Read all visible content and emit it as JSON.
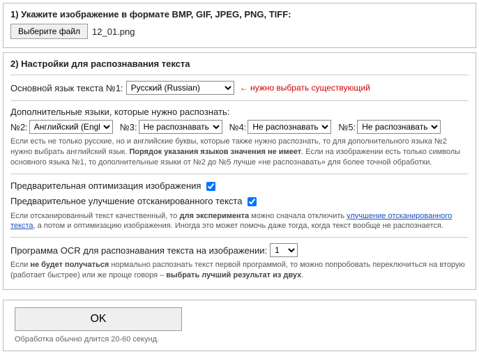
{
  "section1": {
    "title": "1) Укажите изображение в формате BMP, GIF, JPEG, PNG, TIFF:",
    "file_button": "Выберите файл",
    "filename": "12_01.png"
  },
  "section2": {
    "title": "2) Настройки для распознавания текста",
    "main_lang_label": "Основной язык текста №1:",
    "main_lang_value": "Русский (Russian)",
    "main_lang_hint": "← нужно выбрать существующий",
    "extra_label": "Дополнительные языки, которые нужно распознать:",
    "lang2_label": "№2:",
    "lang2_value": "Английский (Englis",
    "lang3_label": "№3:",
    "lang3_value": "Не распознавать",
    "lang4_label": "№4:",
    "lang4_value": "Не распознавать",
    "lang5_label": "№5:",
    "lang5_value": "Не распознавать",
    "note1_a": "Если есть не только русские, но и английские буквы, которые также нужно распознать, то для дополнительного языка №2 нужно выбрать английский язык. ",
    "note1_b": "Порядок указания языков значения не имеет",
    "note1_c": ". Если на изображении есть только символы основного языка №1, то дополнительные языки от №2 до №5 лучше «не распознавать» для более точной обработки.",
    "cb1_label": "Предварительная оптимизация изображения",
    "cb2_label": "Предварительное улучшение отсканированного текста",
    "note2_a": "Если отсканированный текст качественный, то ",
    "note2_b": "для эксперимента",
    "note2_c": " можно сначала отключить ",
    "note2_link": "улучшение отсканированного текста",
    "note2_d": ", а потом и оптимизацию изображения. Иногда это может помочь даже тогда, когда текст вообще не распознается.",
    "prog_label": "Программа OCR для распознавания текста на изображении:",
    "prog_value": "1",
    "note3_a": "Если ",
    "note3_b": "не будет получаться",
    "note3_c": " нормально распознать текст первой программой, то можно попробовать переключиться на вторую (работает быстрее) или же проще говоря – ",
    "note3_d": "выбрать лучший результат из двух",
    "note3_e": "."
  },
  "footer": {
    "ok": "OK",
    "note": "Обработка обычно длится 20-60 секунд."
  }
}
